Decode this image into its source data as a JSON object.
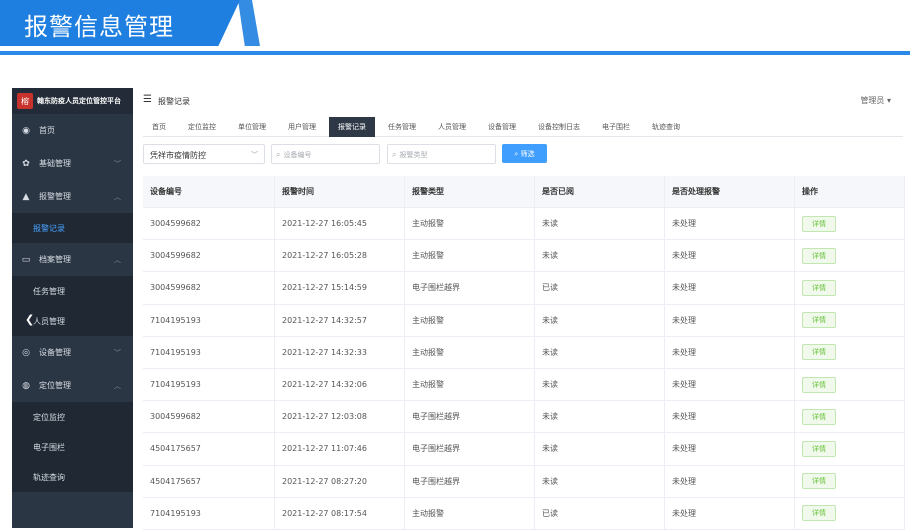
{
  "banner": {
    "title": "报警信息管理"
  },
  "logo": {
    "mark": "榕",
    "text": "翰东防疫人员定位管控平台"
  },
  "sidebar": {
    "items": [
      {
        "icon": "dashboard-icon",
        "glyph": "◉",
        "label": "首页"
      },
      {
        "icon": "gear-icon",
        "glyph": "✿",
        "label": "基础管理",
        "chevron": "﹀"
      },
      {
        "icon": "bell-icon",
        "glyph": "▲",
        "label": "报警管理",
        "chevron": "︿"
      },
      {
        "label": "报警记录",
        "sub": true,
        "active": true
      },
      {
        "icon": "folder-icon",
        "glyph": "▭",
        "label": "档案管理",
        "chevron": "︿"
      },
      {
        "label": "任务管理",
        "sub": true
      },
      {
        "label": "人员管理",
        "sub": true,
        "back": "❮"
      },
      {
        "icon": "watch-icon",
        "glyph": "◎",
        "label": "设备管理",
        "chevron": "﹀"
      },
      {
        "icon": "location-icon",
        "glyph": "◍",
        "label": "定位管理",
        "chevron": "︿"
      },
      {
        "label": "定位监控",
        "sub": true
      },
      {
        "label": "电子围栏",
        "sub": true
      },
      {
        "label": "轨迹查询",
        "sub": true
      }
    ]
  },
  "header": {
    "menu_glyph": "☰",
    "title": "报警记录",
    "user": "管理员 ▾"
  },
  "tabs": [
    "首页",
    "定位监控",
    "单位管理",
    "用户管理",
    "报警记录",
    "任务管理",
    "人员管理",
    "设备管理",
    "设备控制日志",
    "电子围栏",
    "轨迹查询"
  ],
  "active_tab": 4,
  "filters": {
    "unit_value": "凭祥市疫情防控",
    "unit_arrow": "﹀",
    "search_glyph": "⌕",
    "device_placeholder": "设备编号",
    "type_placeholder": "报警类型",
    "search_button": "⌕ 筛选"
  },
  "table": {
    "headers": [
      "设备编号",
      "报警时间",
      "报警类型",
      "是否已阅",
      "是否处理报警",
      "操作"
    ],
    "detail_label": "详情",
    "rows": [
      [
        "3004599682",
        "2021-12-27 16:05:45",
        "主动报警",
        "未读",
        "未处理"
      ],
      [
        "3004599682",
        "2021-12-27 16:05:28",
        "主动报警",
        "未读",
        "未处理"
      ],
      [
        "3004599682",
        "2021-12-27 15:14:59",
        "电子围栏越界",
        "已读",
        "未处理"
      ],
      [
        "7104195193",
        "2021-12-27 14:32:57",
        "主动报警",
        "未读",
        "未处理"
      ],
      [
        "7104195193",
        "2021-12-27 14:32:33",
        "主动报警",
        "未读",
        "未处理"
      ],
      [
        "7104195193",
        "2021-12-27 14:32:06",
        "主动报警",
        "未读",
        "未处理"
      ],
      [
        "3004599682",
        "2021-12-27 12:03:08",
        "电子围栏越界",
        "未读",
        "未处理"
      ],
      [
        "4504175657",
        "2021-12-27 11:07:46",
        "电子围栏越界",
        "未读",
        "未处理"
      ],
      [
        "4504175657",
        "2021-12-27 08:27:20",
        "电子围栏越界",
        "未读",
        "未处理"
      ],
      [
        "7104195193",
        "2021-12-27 08:17:54",
        "主动报警",
        "已读",
        "未处理"
      ]
    ]
  }
}
